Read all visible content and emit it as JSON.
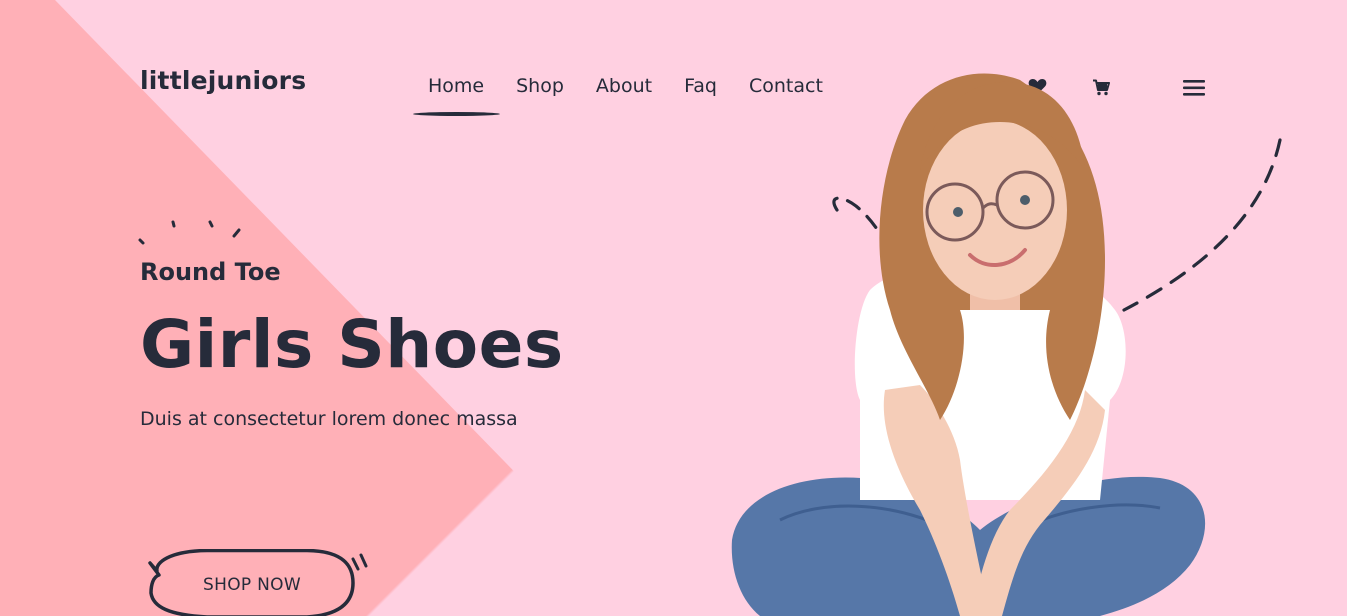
{
  "brand": {
    "logo": "littlejuniors"
  },
  "nav": {
    "items": [
      {
        "label": "Home",
        "active": true
      },
      {
        "label": "Shop",
        "active": false
      },
      {
        "label": "About",
        "active": false
      },
      {
        "label": "Faq",
        "active": false
      },
      {
        "label": "Contact",
        "active": false
      }
    ]
  },
  "header_icons": {
    "user": "user-icon",
    "wishlist": "heart-icon",
    "cart": "cart-icon",
    "menu": "hamburger-menu-icon"
  },
  "hero": {
    "subtitle": "Round Toe",
    "title": "Girls Shoes",
    "description": "Duis at consectetur lorem donec massa",
    "cta_label": "SHOP NOW",
    "image": "girl-sitting-photo"
  },
  "colors": {
    "background_pink": "#ffd0e1",
    "panel_salmon": "#ffb0b7",
    "text_dark": "#262b3a",
    "shirt_white": "#ffffff",
    "jeans_blue": "#5677a8",
    "hair_brown": "#b87b4b",
    "skin": "#f5cdb8"
  }
}
